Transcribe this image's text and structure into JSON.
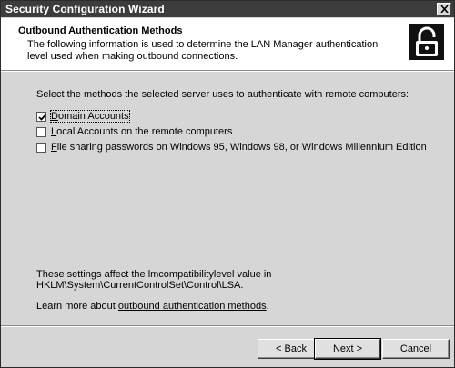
{
  "window": {
    "title": "Security Configuration Wizard"
  },
  "header": {
    "title": "Outbound Authentication Methods",
    "description": "The following information is used to determine the LAN Manager authentication level used when making outbound connections.",
    "icon": "padlock-icon"
  },
  "main": {
    "prompt": "Select the methods the selected server uses to authenticate with remote computers:",
    "options": [
      {
        "label": "Domain Accounts",
        "accel": "D",
        "rest": "omain Accounts",
        "checked": true
      },
      {
        "label": "Local Accounts on the remote computers",
        "accel": "L",
        "rest": "ocal Accounts on the remote computers",
        "checked": false
      },
      {
        "label": "File sharing passwords on Windows 95, Windows 98, or Windows Millennium Edition",
        "accel": "F",
        "rest": "ile sharing passwords on Windows 95, Windows 98, or Windows Millennium Edition",
        "checked": false
      }
    ],
    "note_line1": "These settings affect the lmcompatibilitylevel value in",
    "note_line2": "HKLM\\System\\CurrentControlSet\\Control\\LSA.",
    "learn_prefix": "Learn more about ",
    "learn_link": "outbound authentication methods",
    "learn_suffix": "."
  },
  "buttons": {
    "back_prefix": "< ",
    "back_accel": "B",
    "back_rest": "ack",
    "next_accel": "N",
    "next_rest": "ext >",
    "cancel": "Cancel"
  }
}
